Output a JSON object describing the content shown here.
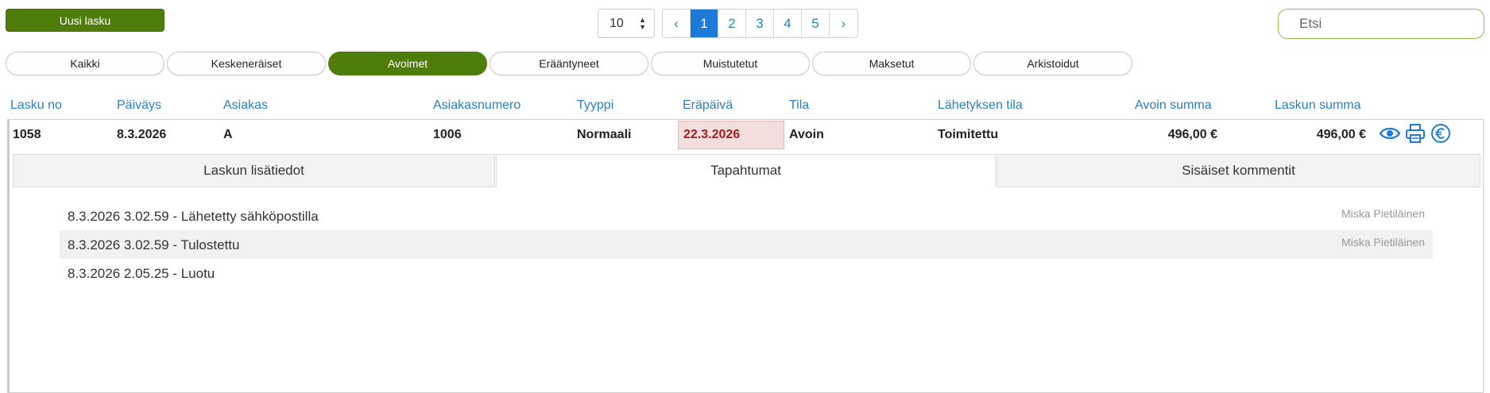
{
  "toolbar": {
    "new_invoice_label": "Uusi lasku",
    "page_size": "10",
    "pager": [
      "‹",
      "1",
      "2",
      "3",
      "4",
      "5",
      "›"
    ],
    "active_page": "1",
    "search_placeholder": "Etsi"
  },
  "filters": [
    {
      "label": "Kaikki",
      "active": false
    },
    {
      "label": "Keskeneräiset",
      "active": false
    },
    {
      "label": "Avoimet",
      "active": true
    },
    {
      "label": "Erääntyneet",
      "active": false
    },
    {
      "label": "Muistutetut",
      "active": false
    },
    {
      "label": "Maksetut",
      "active": false
    },
    {
      "label": "Arkistoidut",
      "active": false
    }
  ],
  "columns": {
    "invoice_no": "Lasku no",
    "date": "Päiväys",
    "customer": "Asiakas",
    "customer_no": "Asiakasnumero",
    "type": "Tyyppi",
    "due_date": "Eräpäivä",
    "status": "Tila",
    "send_status": "Lähetyksen tila",
    "open_sum": "Avoin summa",
    "invoice_sum": "Laskun summa"
  },
  "invoice": {
    "invoice_no": "1058",
    "date": "8.3.2026",
    "customer": "A",
    "customer_no": "1006",
    "type": "Normaali",
    "due_date": "22.3.2026",
    "status": "Avoin",
    "send_status": "Toimitettu",
    "open_sum": "496,00 €",
    "invoice_sum": "496,00 €",
    "actions": [
      "eye-icon",
      "printer-icon",
      "euro-icon"
    ]
  },
  "detail_tabs": [
    {
      "label": "Laskun lisätiedot",
      "active": false
    },
    {
      "label": "Tapahtumat",
      "active": true
    },
    {
      "label": "Sisäiset kommentit",
      "active": false
    }
  ],
  "events": [
    {
      "text": "8.3.2026 3.02.59 - Lähetetty sähköpostilla",
      "user": "Miska Pietiläinen"
    },
    {
      "text": "8.3.2026 3.02.59 - Tulostettu",
      "user": "Miska Pietiläinen"
    },
    {
      "text": "8.3.2026 2.05.25 - Luotu",
      "user": ""
    }
  ],
  "colors": {
    "brand_green": "#4f7d0b",
    "link_blue": "#2b7fc1",
    "overdue_bg": "#f3dede",
    "overdue_text": "#a31f1f"
  }
}
